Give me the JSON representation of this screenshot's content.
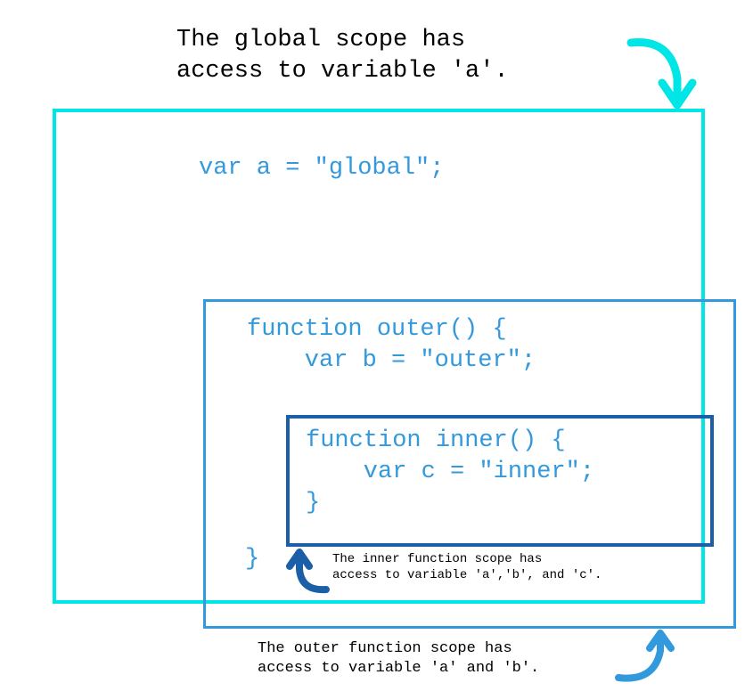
{
  "title": "The global scope has\naccess to variable 'a'.",
  "code": {
    "global_declaration": "var a = \"global\";",
    "outer_function_open": "function outer() {",
    "outer_var_declaration": "    var b = \"outer\";",
    "inner_function_open": "function inner() {",
    "inner_var_declaration": "    var c = \"inner\";",
    "inner_close": "}",
    "outer_close": "}"
  },
  "annotations": {
    "inner": "The inner function scope has\naccess to variable 'a','b', and 'c'.",
    "outer": "The outer function scope has\naccess to variable 'a' and 'b'."
  },
  "colors": {
    "global_border": "#00E5E5",
    "outer_border": "#3399DD",
    "inner_border": "#1A5FA8",
    "code_text": "#3399DD",
    "arrow_global": "#00E5E5",
    "arrow_inner": "#1A5FA8",
    "arrow_outer": "#3399DD"
  }
}
